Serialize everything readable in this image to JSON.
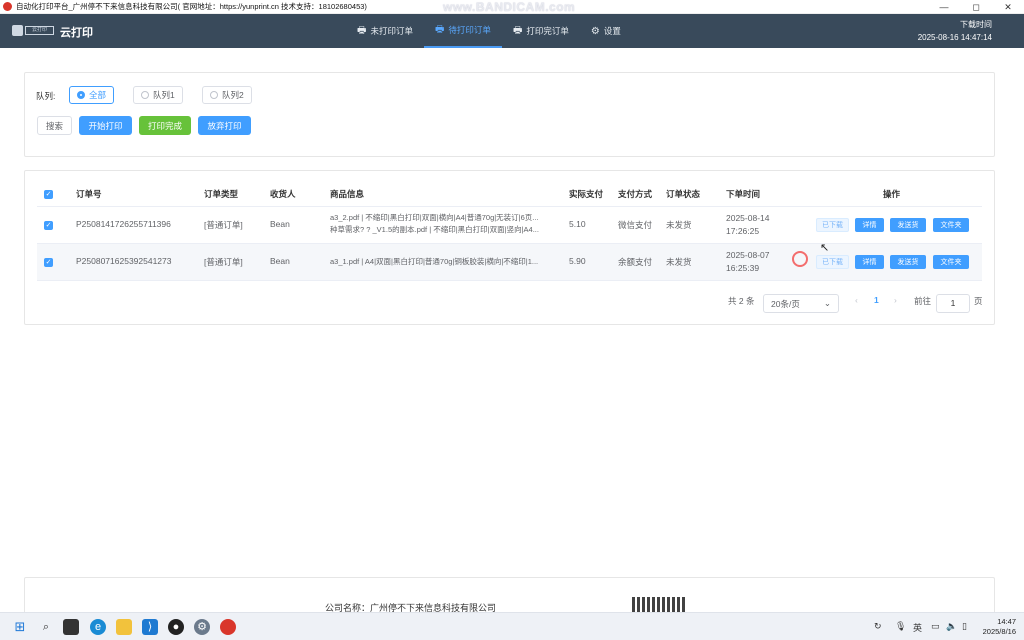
{
  "window": {
    "title": "自动化打印平台_广州停不下来信息科技有限公司( 官网地址：https://yunprint.cn 技术支持：18102680453)",
    "watermark": "www.BANDICAM.com",
    "controls": [
      "—",
      "◻",
      "✕"
    ]
  },
  "header": {
    "logo_text": "云打印",
    "brand": "云打印",
    "nav": [
      {
        "label": "未打印订单",
        "icon": "printer-icon",
        "active": false
      },
      {
        "label": "待打印订单",
        "icon": "printer-icon",
        "active": true
      },
      {
        "label": "打印完订单",
        "icon": "printer-icon",
        "active": false
      },
      {
        "label": "设置",
        "icon": "gear-icon",
        "active": false
      }
    ],
    "download_time_label": "下载时间",
    "download_time_value": "2025-08-16 14:47:14"
  },
  "filter": {
    "queue_label": "队列:",
    "queues": [
      {
        "label": "全部",
        "checked": true
      },
      {
        "label": "队列1",
        "checked": false
      },
      {
        "label": "队列2",
        "checked": false
      }
    ],
    "buttons": {
      "search": "搜索",
      "start_print": "开始打印",
      "print_done": "打印完成",
      "abandon_print": "放弃打印"
    }
  },
  "table": {
    "headers": {
      "order_no": "订单号",
      "order_type": "订单类型",
      "receiver": "收货人",
      "goods": "商品信息",
      "paid": "实际支付",
      "pay_method": "支付方式",
      "status": "订单状态",
      "order_time": "下单时间",
      "actions": "操作"
    },
    "rows": [
      {
        "order_no": "P2508141726255711396",
        "order_type": "[普通订单]",
        "receiver": "Bean",
        "goods_line1": "a3_2.pdf | 不缩印|黑白打印|双面|横向|A4|普通70g|无装订|6页...",
        "goods_line2": "种草需求? ? _V1.5的副本.pdf | 不缩印|黑白打印|双面|竖向|A4...",
        "paid": "5.10",
        "pay_method": "微信支付",
        "status": "未发货",
        "date": "2025-08-14",
        "time": "17:26:25"
      },
      {
        "order_no": "P2508071625392541273",
        "order_type": "[普通订单]",
        "receiver": "Bean",
        "goods_line1": "a3_1.pdf | A4|双面|黑白打印|普通70g|铜板胶装|横向|不缩印|1...",
        "goods_line2": "",
        "paid": "5.90",
        "pay_method": "余额支付",
        "status": "未发货",
        "date": "2025-08-07",
        "time": "16:25:39"
      }
    ],
    "row_actions": {
      "downloaded": "已下载",
      "detail": "详情",
      "ship": "发送货",
      "folder": "文件夹"
    }
  },
  "pagination": {
    "total": "共 2 条",
    "page_size": "20条/页",
    "prev": "‹",
    "current": "1",
    "next": "›",
    "goto_label": "前往",
    "goto_value": "1",
    "page_suffix": "页"
  },
  "footer": {
    "company": "公司名称：广州停不下来信息科技有限公司"
  },
  "taskbar": {
    "tray_lang": "英",
    "clock_time": "14:47",
    "clock_date": "2025/8/16"
  }
}
